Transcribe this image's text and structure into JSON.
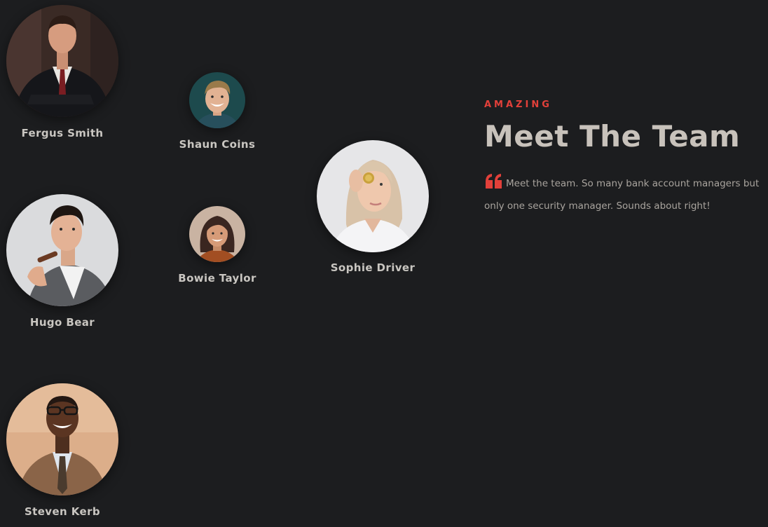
{
  "section": {
    "eyebrow": "AMAZING",
    "title": "Meet The Team",
    "blurb": "Meet the team. So many bank account managers but only one security manager. Sounds about right!",
    "quote_icon": "quote-icon",
    "accent_color": "#e2403a",
    "background_color": "#1c1d1f"
  },
  "members": {
    "fergus": {
      "name": "Fergus Smith"
    },
    "shaun": {
      "name": "Shaun Coins"
    },
    "sophie": {
      "name": "Sophie Driver"
    },
    "hugo": {
      "name": "Hugo Bear"
    },
    "bowie": {
      "name": "Bowie Taylor"
    },
    "steven": {
      "name": "Steven Kerb"
    }
  }
}
